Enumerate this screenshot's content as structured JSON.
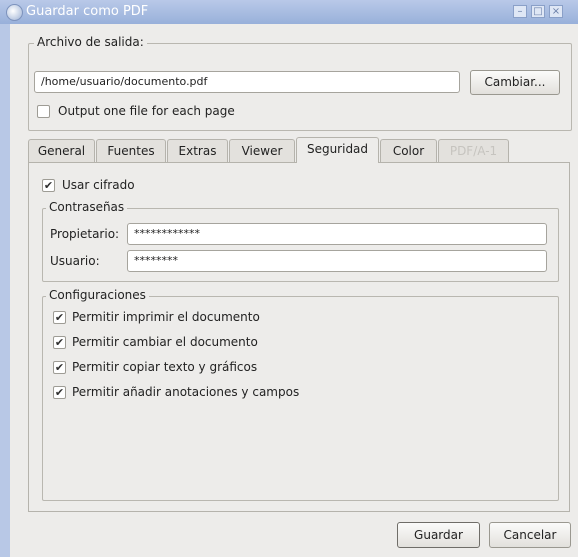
{
  "window": {
    "title": "Guardar como PDF",
    "buttons": {
      "minimize": "–",
      "maximize": "□",
      "close": "×"
    }
  },
  "output": {
    "group_label": "Archivo de salida:",
    "path": "/home/usuario/documento.pdf",
    "change_button": "Cambiar...",
    "one_file_label": "Output one file for each page",
    "one_file_checked": false
  },
  "tabs": [
    {
      "label": "General"
    },
    {
      "label": "Fuentes"
    },
    {
      "label": "Extras"
    },
    {
      "label": "Viewer"
    },
    {
      "label": "Seguridad"
    },
    {
      "label": "Color"
    },
    {
      "label": "PDF/A-1"
    }
  ],
  "active_tab": "Seguridad",
  "security": {
    "encrypt_label": "Usar cifrado",
    "encrypt_checked": true,
    "passwords": {
      "group_label": "Contraseñas",
      "owner_label": "Propietario:",
      "owner_value": "************",
      "user_label": "Usuario:",
      "user_value": "********"
    },
    "settings": {
      "group_label": "Configuraciones",
      "options": [
        {
          "label": "Permitir imprimir el documento",
          "checked": true
        },
        {
          "label": "Permitir cambiar el documento",
          "checked": true
        },
        {
          "label": "Permitir copiar texto y gráficos",
          "checked": true
        },
        {
          "label": "Permitir añadir anotaciones y campos",
          "checked": true
        }
      ]
    }
  },
  "footer": {
    "save": "Guardar",
    "cancel": "Cancelar"
  },
  "check_glyph": "✔"
}
